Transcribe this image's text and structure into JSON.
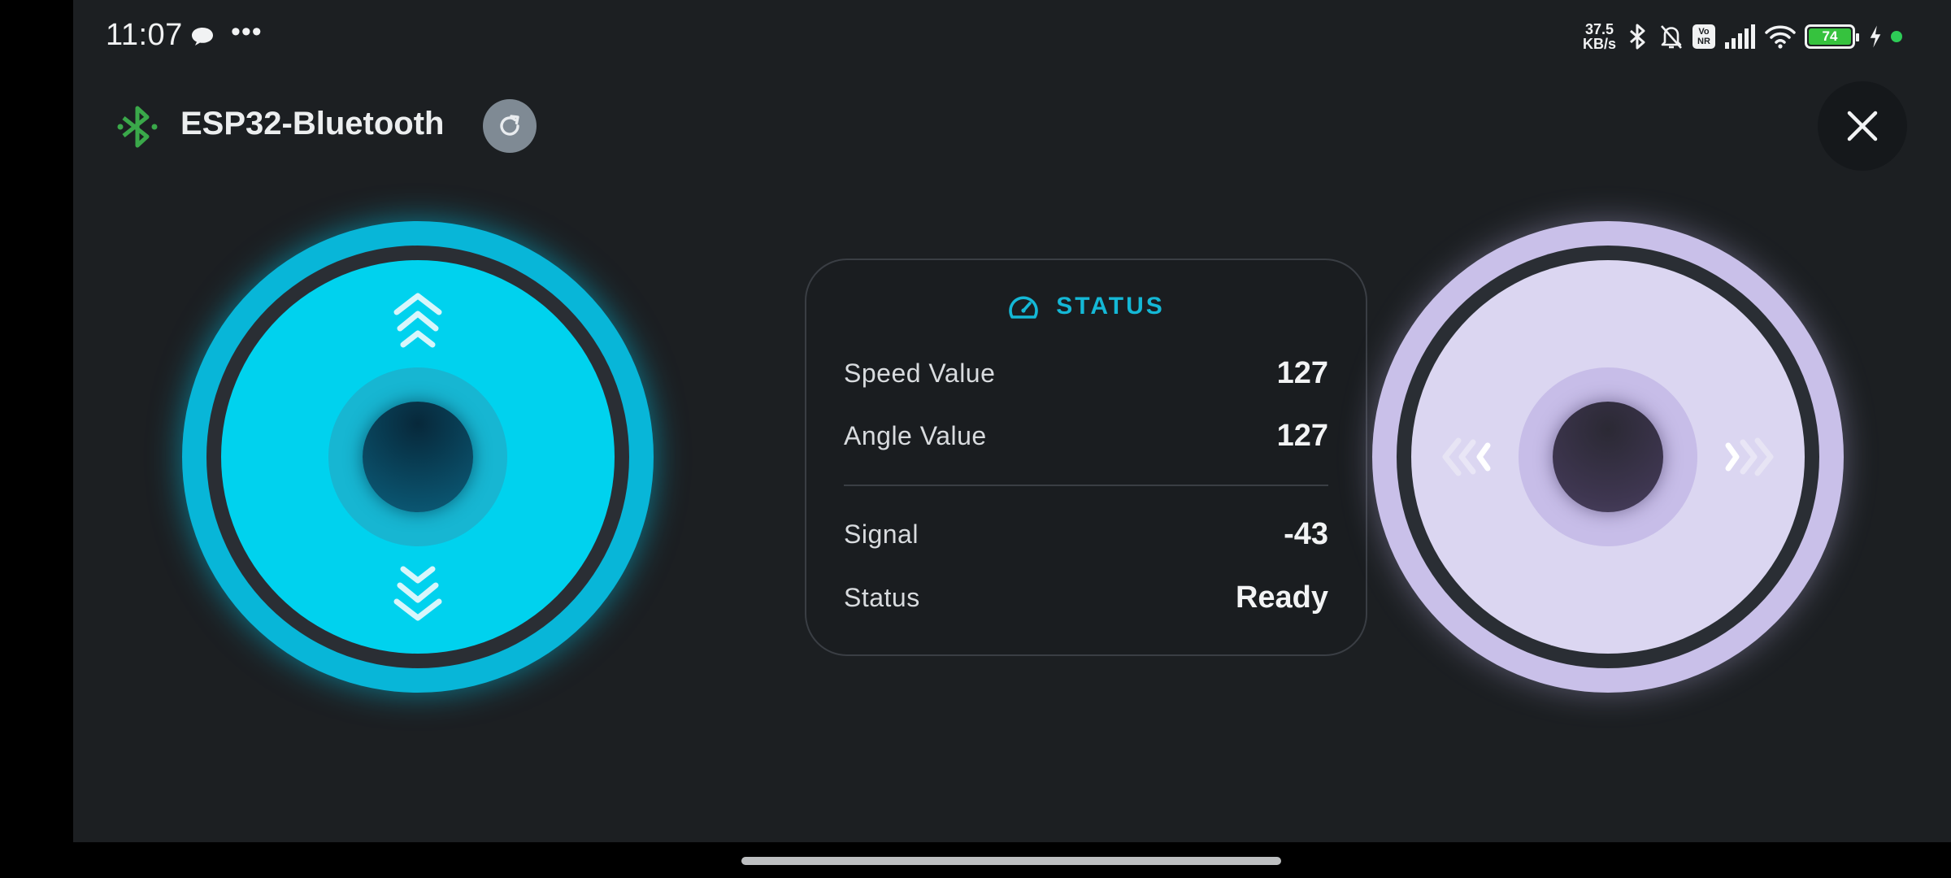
{
  "status_bar": {
    "time": "11:07",
    "notification_icons": [
      "chat-bubble-icon",
      "more-dots-icon"
    ],
    "more_glyph": "•••",
    "network_rate_value": "37.5",
    "network_rate_unit": "KB/s",
    "vonr_label": "Vo\nNR",
    "battery_level": "74",
    "icons": [
      "bluetooth-icon",
      "bell-off-icon",
      "vonr-icon",
      "signal-icon",
      "wifi-icon",
      "battery-icon",
      "charging-icon",
      "privacy-dot"
    ]
  },
  "header": {
    "device_name": "ESP32-Bluetooth",
    "bluetooth_icon": "bluetooth-icon",
    "refresh_icon": "refresh-icon",
    "close_icon": "close-icon"
  },
  "joysticks": {
    "left": {
      "axis": "vertical",
      "arrows": [
        "chevrons-up-icon",
        "chevrons-down-icon"
      ]
    },
    "right": {
      "axis": "horizontal",
      "arrows": [
        "chevrons-left-icon",
        "chevrons-right-icon"
      ]
    }
  },
  "status_card": {
    "title": "STATUS",
    "title_icon": "speedometer-icon",
    "rows": [
      {
        "label": "Speed Value",
        "value": "127"
      },
      {
        "label": "Angle Value",
        "value": "127"
      },
      {
        "label": "Signal",
        "value": "-43"
      },
      {
        "label": "Status",
        "value": "Ready"
      }
    ]
  },
  "colors": {
    "background": "#1c1f22",
    "accent_cyan": "#00d2ee",
    "accent_lavender": "#dbd6f1",
    "bluetooth_green": "#3aa84a",
    "battery_green": "#36c23e"
  }
}
